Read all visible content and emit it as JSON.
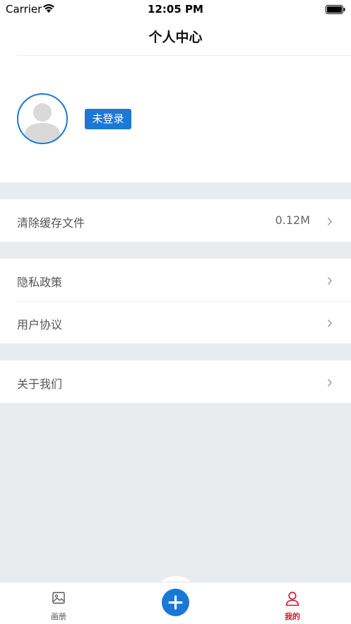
{
  "status_bar": {
    "carrier": "Carrier",
    "time": "12:05 PM"
  },
  "nav": {
    "title": "个人中心"
  },
  "profile": {
    "login_status": "未登录"
  },
  "settings": {
    "clear_cache": {
      "label": "清除缓存文件",
      "value": "0.12M"
    },
    "privacy_policy": {
      "label": "隐私政策"
    },
    "user_agreement": {
      "label": "用户协议"
    },
    "about_us": {
      "label": "关于我们"
    }
  },
  "tab_bar": {
    "album": {
      "label": "画册",
      "icon": "image-icon"
    },
    "add": {
      "icon": "plus-icon"
    },
    "mine": {
      "label": "我的",
      "icon": "user-icon",
      "active": true
    }
  },
  "colors": {
    "accent": "#1a78d6",
    "active_tab": "#d0132c",
    "background": "#e9ecef"
  }
}
